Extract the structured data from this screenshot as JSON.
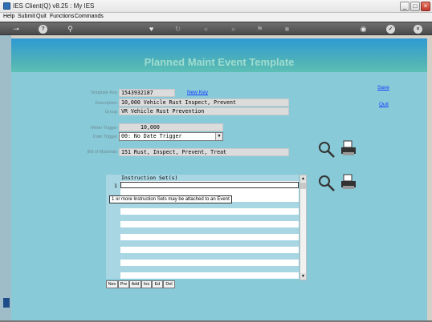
{
  "window": {
    "title": "IES Client(Q) v8.25 : My IES",
    "controls": [
      "_",
      "□",
      "×"
    ]
  },
  "menu": [
    "Help",
    "Submit",
    "Quit",
    "Functions",
    "Commands"
  ],
  "page_title": "Planned Maint Event Template",
  "form": {
    "template_key_label": "Template Key",
    "template_key_value": "1543932187",
    "new_key_link": "New Key",
    "description_label": "Description",
    "description_value": "10,000 Vehicle Rust Inspect, Prevent",
    "group_label": "Group",
    "group_value": "VR Vehicle Rust Prevention",
    "meter_trigger_label": "Meter Trigger",
    "meter_trigger_value": "10,000",
    "date_trigger_label": "Date Trigger",
    "date_trigger_value": "00: No Date Trigger",
    "bill_of_materials_label": "Bill of Materials",
    "bill_of_materials_value": "151 Rust, Inspect, Prevent, Treat"
  },
  "actions": {
    "save": "Save",
    "quit": "Quit"
  },
  "grid": {
    "header": "Instruction Set(s)",
    "row_number": "1",
    "tooltip": "1 or more Instruction Sets may be attached to an Event",
    "buttons": [
      "Nev",
      "Pre",
      "Add",
      "Ins",
      "Ed",
      "Del"
    ]
  },
  "colors": {
    "content_bg": "#88cad8",
    "link": "#1a3cff",
    "header_gradient_top": "#2e9ad3"
  }
}
